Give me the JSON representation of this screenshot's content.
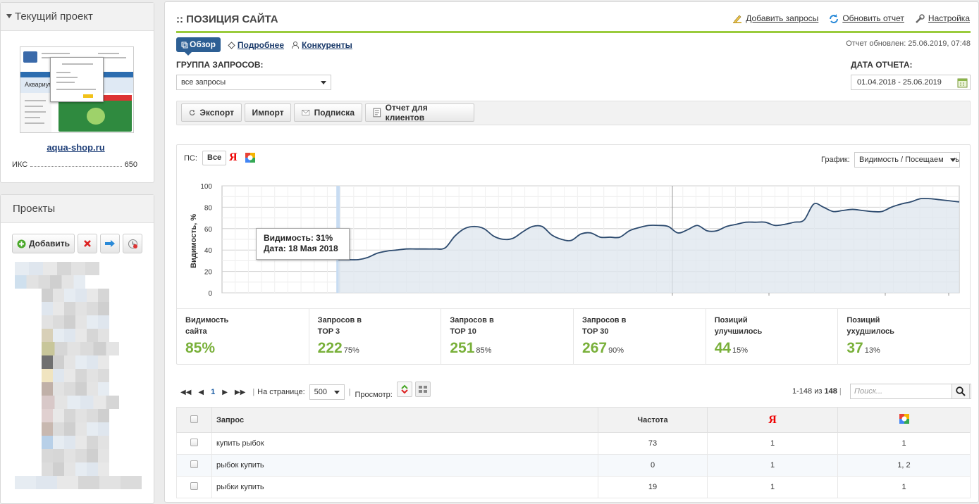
{
  "current_project": {
    "header": "Текущий проект",
    "site": "aqua-shop.ru",
    "iks_label": "ИКС",
    "iks_value": "650",
    "thumb_text": "Аквариум"
  },
  "projects": {
    "header": "Проекты",
    "add_label": "Добавить"
  },
  "main": {
    "title": ":: ПОЗИЦИЯ САЙТА",
    "links": {
      "add_queries": "Добавить запросы",
      "refresh": "Обновить отчет",
      "settings": "Настройка"
    },
    "tabs": {
      "overview": "Обзор",
      "details": "Подробнее",
      "competitors": "Конкуренты"
    },
    "updated": "Отчет обновлен: 25.06.2019, 07:48",
    "group_label": "ГРУППА ЗАПРОСОВ:",
    "group_value": "все запросы",
    "date_label": "ДАТА ОТЧЕТА:",
    "date_value": "01.04.2018 - 25.06.2019",
    "toolbar": {
      "export": "Экспорт",
      "import": "Импорт",
      "subscribe": "Подписка",
      "client_report": "Отчет для клиентов"
    }
  },
  "chart_panel": {
    "ps_label": "ПС:",
    "ps_all": "Все",
    "yandex": "Я",
    "graph_label": "График:",
    "graph_value": "Видимость / Посещаемость",
    "tooltip_line1": "Видимость: 31%",
    "tooltip_line2": "Дата: 18 Мая 2018"
  },
  "chart_data": {
    "type": "area",
    "ylabel": "Видимость, %",
    "ylim": [
      0,
      100
    ],
    "yticks": [
      "0",
      "20",
      "40",
      "60",
      "80",
      "100"
    ],
    "grid": true,
    "series": [
      {
        "values": [
          null,
          null,
          null,
          null,
          null,
          null,
          null,
          null,
          null,
          null,
          null,
          null,
          31,
          31,
          31,
          33,
          37,
          39,
          40,
          41,
          41,
          41,
          41,
          42,
          53,
          60,
          62,
          60,
          53,
          50,
          51,
          57,
          62,
          62,
          54,
          50,
          49,
          55,
          56,
          52,
          52,
          52,
          58,
          61,
          63,
          63,
          62,
          56,
          59,
          63,
          58,
          58,
          62,
          64,
          66,
          66,
          66,
          63,
          64,
          66,
          68,
          83,
          80,
          76,
          77,
          78,
          77,
          76,
          76,
          80,
          83,
          85,
          88,
          88,
          87,
          86,
          85
        ]
      }
    ]
  },
  "stats": [
    {
      "title": "Видимость\nсайта",
      "value": "85%",
      "pct": ""
    },
    {
      "title": "Запросов в\nTOP 3",
      "value": "222",
      "pct": "75%"
    },
    {
      "title": "Запросов в\nTOP 10",
      "value": "251",
      "pct": "85%"
    },
    {
      "title": "Запросов в\nTOP 30",
      "value": "267",
      "pct": "90%"
    },
    {
      "title": "Позиций\nулучшилось",
      "value": "44",
      "pct": "15%"
    },
    {
      "title": "Позиций\nухудшилось",
      "value": "37",
      "pct": "13%"
    }
  ],
  "pager": {
    "page": "1",
    "per_page_label": "На странице:",
    "per_page": "500",
    "view_label": "Просмотр:",
    "count_range": "1-148 из",
    "count_total": "148",
    "search_placeholder": "Поиск..."
  },
  "table": {
    "headers": {
      "query": "Запрос",
      "freq": "Частота",
      "yandex": "Я"
    },
    "rows": [
      {
        "query": "купить рыбок",
        "freq": "73",
        "yandex": "1",
        "google": "1"
      },
      {
        "query": "рыбок купить",
        "freq": "0",
        "yandex": "1",
        "google": "1, 2"
      },
      {
        "query": "рыбки купить",
        "freq": "19",
        "yandex": "1",
        "google": "1"
      }
    ]
  },
  "colors": {
    "accent_green": "#9acb3c",
    "value_green": "#79b03a",
    "tab_blue": "#2d5f94",
    "line": "#2c4a6e"
  }
}
